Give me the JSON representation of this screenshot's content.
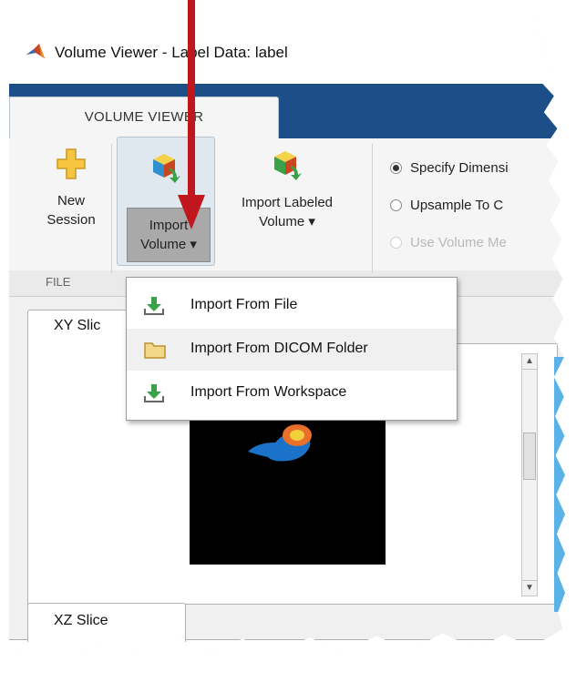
{
  "window": {
    "title": "Volume Viewer - Label Data: label"
  },
  "tabs": [
    {
      "label": "VOLUME VIEWER"
    }
  ],
  "toolstrip": {
    "new_session": {
      "line1": "New",
      "line2": "Session"
    },
    "import_volume": {
      "line1": "Import",
      "line2": "Volume ▾"
    },
    "import_labeled_volume": {
      "line1": "Import Labeled",
      "line2": "Volume ▾"
    },
    "radios": [
      {
        "label": "Specify Dimensi",
        "selected": true,
        "enabled": true
      },
      {
        "label": "Upsample To C",
        "selected": false,
        "enabled": true
      },
      {
        "label": "Use Volume Me",
        "selected": false,
        "enabled": false
      }
    ],
    "section_label": "FILE"
  },
  "dropdown": {
    "items": [
      {
        "label": "Import From File",
        "icon": "import-arrow-icon"
      },
      {
        "label": "Import From DICOM Folder",
        "icon": "folder-icon"
      },
      {
        "label": "Import From Workspace",
        "icon": "import-arrow-icon"
      }
    ]
  },
  "views": {
    "xy_tab": "XY Slic",
    "xz_tab": "XZ Slice"
  },
  "colors": {
    "tabstrip": "#1c4f87",
    "annotation_arrow": "#c0171e",
    "label_blue": "#1a73c9",
    "label_orange": "#e8702a"
  }
}
